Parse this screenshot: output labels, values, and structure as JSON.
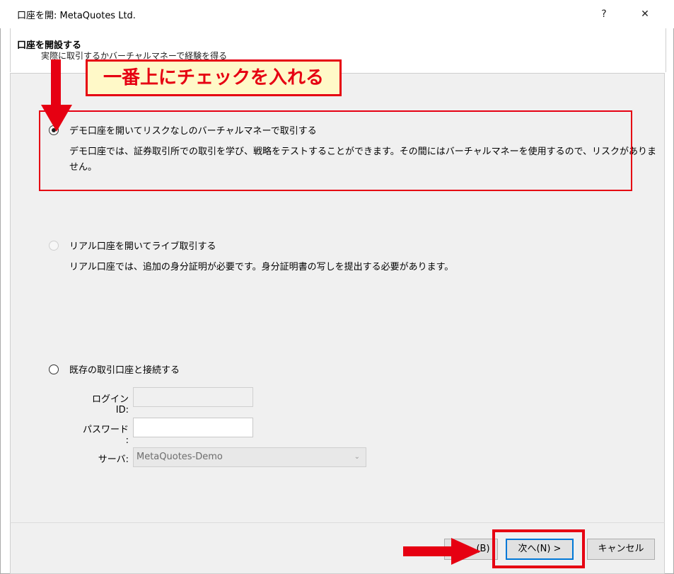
{
  "window": {
    "title": "口座を開: MetaQuotes Ltd.",
    "help_label": "?",
    "close_label": "✕"
  },
  "header": {
    "title": "口座を開設する",
    "subtitle": "実際に取引するかバーチャルマネーで経験を得る"
  },
  "annotation": {
    "callout": "一番上にチェックを入れる"
  },
  "options": [
    {
      "label": "デモ口座を開いてリスクなしのバーチャルマネーで取引する",
      "desc_line1": "デモ口座では、証券取引所での取引を学び、戦略をテストすることができます。その間にはバーチャルマネーを使用するので、リスクがありま",
      "desc_line2": "せん。",
      "checked": true
    },
    {
      "label": "リアル口座を開いてライブ取引する",
      "desc": "リアル口座では、追加の身分証明が必要です。身分証明書の写しを提出する必要があります。",
      "checked": false
    },
    {
      "label": "既存の取引口座と接続する",
      "checked": false
    }
  ],
  "login_form": {
    "login_label": "ログインID:",
    "login_value": "",
    "password_label": "パスワード :",
    "password_value": "",
    "server_label": "サーバ:",
    "server_value": "MetaQuotes-Demo"
  },
  "footer": {
    "back_label": "< 戻る(B)",
    "back_visible": "(B)",
    "next_label": "次へ(N) >",
    "cancel_label": "キャンセル"
  },
  "colors": {
    "annotation_red": "#e60012",
    "callout_bg": "#fff9c8",
    "primary_border": "#0078d7"
  }
}
